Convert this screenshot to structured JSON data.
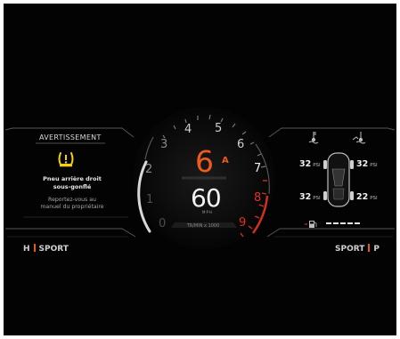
{
  "warning": {
    "title": "AVERTISSEMENT",
    "icon": "tire-pressure-warning-icon",
    "message_line1": "Pneu arrière droit",
    "message_line2": "sous-gonflé",
    "instruction_line1": "Reportez-vous au",
    "instruction_line2": "manuel du propriétaire",
    "icon_color": "#f2cf12"
  },
  "gauge": {
    "gear": "6",
    "gear_mode": "A",
    "speed": "60",
    "speed_unit": "MPH",
    "rpm_label": "TR/MIN x 1000",
    "tick_labels": [
      "0",
      "1",
      "2",
      "3",
      "4",
      "5",
      "6",
      "7",
      "8",
      "9"
    ],
    "accent_color": "#ef5a1f",
    "redline_color": "#e0311e"
  },
  "modes": {
    "left_letter": "H",
    "left_mode": "SPORT",
    "right_mode": "SPORT",
    "right_letter": "P"
  },
  "tires": {
    "front_left": "32",
    "front_right": "32",
    "rear_left": "32",
    "rear_right": "22",
    "unit": "PSI"
  },
  "fuel": {
    "icon": "fuel-pump-icon",
    "level_fraction": 1.0
  },
  "temps": {
    "coolant_icon": "coolant-temp-icon",
    "oil_icon": "oil-temp-icon"
  }
}
